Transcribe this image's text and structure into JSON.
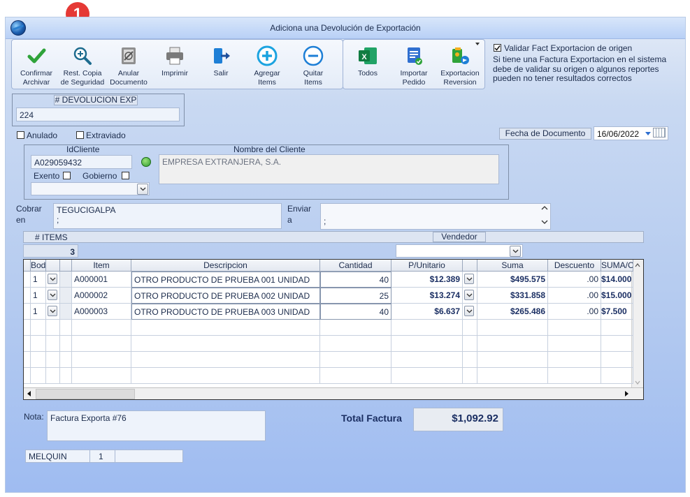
{
  "window": {
    "title": "Adiciona una Devolución de Exportación"
  },
  "callout": {
    "number": "1"
  },
  "toolbar1": [
    {
      "name": "confirmar-archivar-button",
      "icon": "check-icon",
      "label": "Confirmar\nArchivar"
    },
    {
      "name": "rest-copia-button",
      "icon": "zoom-plus-icon",
      "label": "Rest. Copia\nde Seguridad"
    },
    {
      "name": "anular-documento-button",
      "icon": "delete-document-icon",
      "label": "Anular\nDocumento"
    },
    {
      "name": "imprimir-button",
      "icon": "printer-icon",
      "label": "Imprimir"
    },
    {
      "name": "salir-button",
      "icon": "exit-door-icon",
      "label": "Salir"
    },
    {
      "name": "agregar-items-button",
      "icon": "plus-circle-icon",
      "label": "Agregar\nItems"
    },
    {
      "name": "quitar-items-button",
      "icon": "minus-circle-icon",
      "label": "Quitar\nItems"
    }
  ],
  "toolbar2": [
    {
      "name": "todos-button",
      "icon": "excel-icon",
      "label": "Todos"
    },
    {
      "name": "importar-pedido-button",
      "icon": "import-order-icon",
      "label": "Importar\nPedido"
    },
    {
      "name": "exportacion-reversion-button",
      "icon": "export-reversion-icon",
      "label": "Exportacion\nReversion"
    }
  ],
  "validate": {
    "checkbox_label": "Validar Fact Exportacion de origen",
    "checked": true,
    "note": "Si tiene una Factura Exportacion en el sistema\ndebe de validar su origen o algunos reportes\npueden no tener resultados correctos"
  },
  "devolucion": {
    "caption": "# DEVOLUCION EXP",
    "value": "224"
  },
  "anulado_label": "Anulado",
  "extraviado_label": "Extraviado",
  "fecha": {
    "label": "Fecha de  Documento",
    "value": "16/06/2022"
  },
  "cliente": {
    "id_caption": "IdCliente",
    "id_value": "A029059432",
    "nombre_caption": "Nombre del Cliente",
    "nombre_value": "EMPRESA EXTRANJERA, S.A.",
    "exento_label": "Exento",
    "gobierno_label": "Gobierno"
  },
  "cobrar": {
    "label": "Cobrar\nen",
    "value": "TEGUCIGALPA\n;"
  },
  "enviar": {
    "label": "Enviar\na",
    "value": ";"
  },
  "items_caption": "# ITEMS",
  "items_count": "3",
  "vendedor_caption": "Vendedor",
  "grid": {
    "headers": [
      "Bodega",
      "",
      "Item",
      "Descripcion",
      "Cantidad",
      "P/Unitario",
      "",
      "Suma",
      "Descuento",
      "SUMA/CON"
    ],
    "rows": [
      {
        "bodega": "1",
        "item": "A000001",
        "descripcion": "OTRO PRODUCTO DE PRUEBA 001 UNIDAD",
        "cantidad": "40",
        "punitario": "$12.389",
        "suma": "$495.575",
        "descuento": ".00",
        "sumacon": "$14.000"
      },
      {
        "bodega": "1",
        "item": "A000002",
        "descripcion": "OTRO PRODUCTO DE PRUEBA 002 UNIDAD",
        "cantidad": "25",
        "punitario": "$13.274",
        "suma": "$331.858",
        "descuento": ".00",
        "sumacon": "$15.000"
      },
      {
        "bodega": "1",
        "item": "A000003",
        "descripcion": "OTRO PRODUCTO DE PRUEBA 003 UNIDAD",
        "cantidad": "40",
        "punitario": "$6.637",
        "suma": "$265.486",
        "descuento": ".00",
        "sumacon": "$7.500"
      }
    ]
  },
  "nota": {
    "label": "Nota:",
    "value": "Factura Exporta #76"
  },
  "total": {
    "label": "Total Factura",
    "value": "$1,092.92"
  },
  "status": {
    "user": "MELQUIN",
    "num": "1",
    "extra": ""
  }
}
